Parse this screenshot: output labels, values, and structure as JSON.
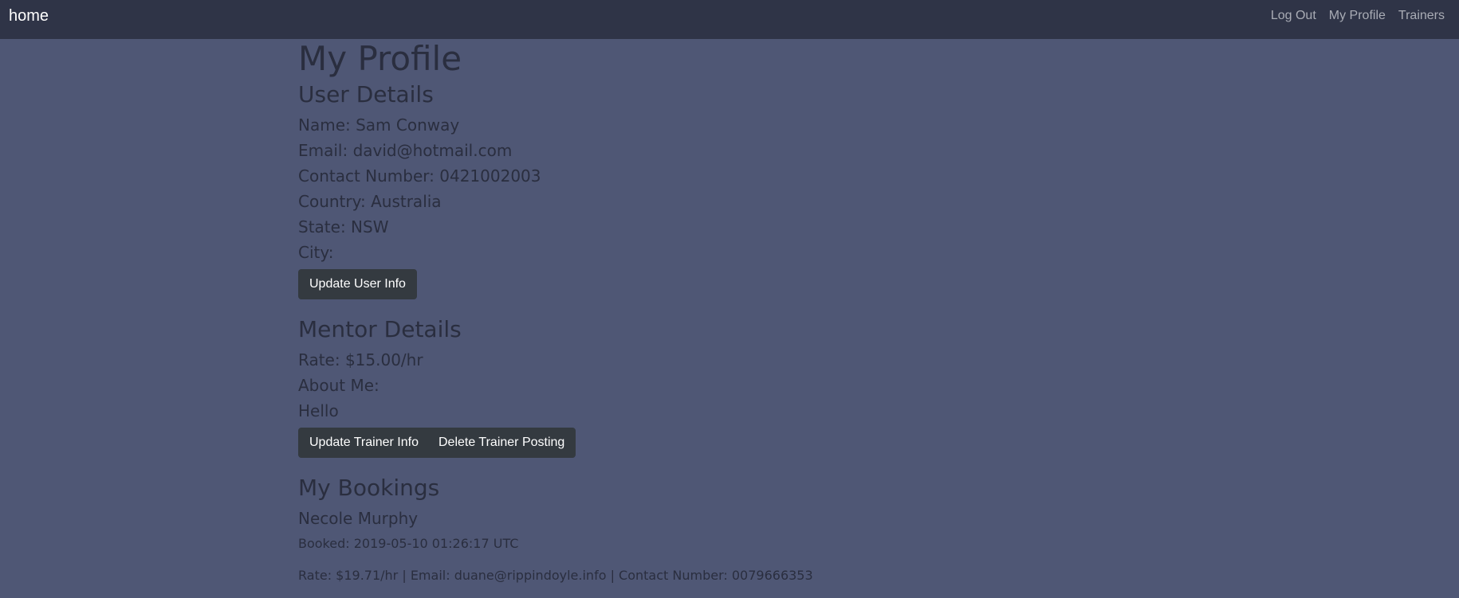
{
  "navbar": {
    "brand": "home",
    "links": [
      "Log Out",
      "My Profile",
      "Trainers"
    ]
  },
  "page": {
    "title": "My Profile"
  },
  "user_details": {
    "heading": "User Details",
    "name": "Name: Sam Conway",
    "email": "Email: david@hotmail.com",
    "contact": "Contact Number: 0421002003",
    "country": "Country: Australia",
    "state": "State: NSW",
    "city": "City:",
    "update_button": "Update User Info"
  },
  "mentor_details": {
    "heading": "Mentor Details",
    "rate": "Rate: $15.00/hr",
    "about_label": "About Me:",
    "about_text": "Hello",
    "update_button": "Update Trainer Info",
    "delete_button": "Delete Trainer Posting"
  },
  "bookings": {
    "heading": "My Bookings",
    "items": [
      {
        "trainer": "Necole Murphy",
        "booked": "Booked: 2019-05-10 01:26:17 UTC",
        "info": "Rate: $19.71/hr | Email: duane@rippindoyle.info | Contact Number: 0079666353"
      }
    ]
  }
}
